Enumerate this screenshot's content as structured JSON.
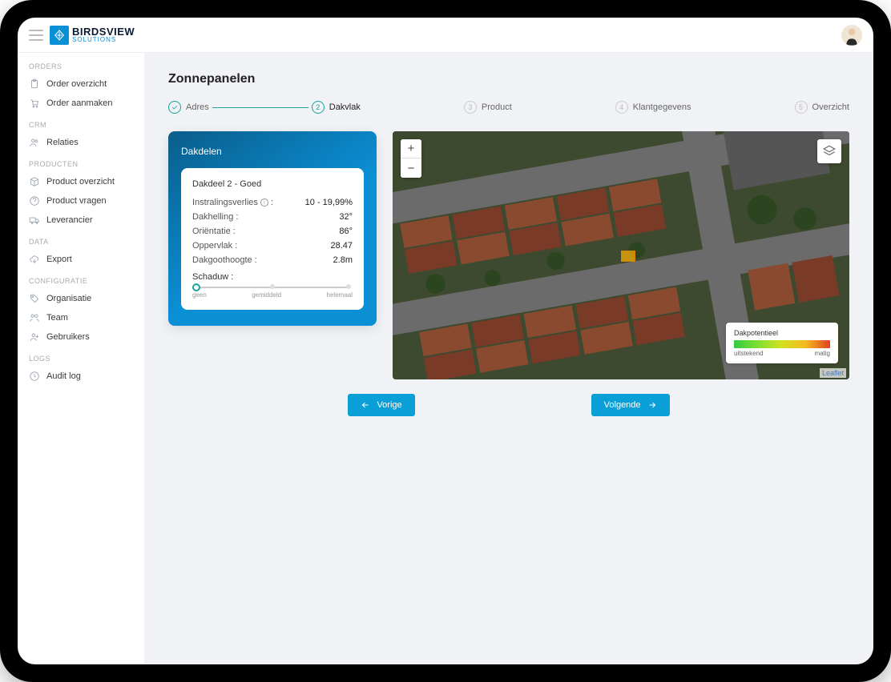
{
  "brand": {
    "primary": "BIRDSVIEW",
    "secondary": "SOLUTIONS"
  },
  "sidebar": {
    "groups": [
      {
        "header": "ORDERS",
        "items": [
          {
            "label": "Order overzicht"
          },
          {
            "label": "Order aanmaken"
          }
        ]
      },
      {
        "header": "CRM",
        "items": [
          {
            "label": "Relaties"
          }
        ]
      },
      {
        "header": "PRODUCTEN",
        "items": [
          {
            "label": "Product overzicht"
          },
          {
            "label": "Product vragen"
          },
          {
            "label": "Leverancier"
          }
        ]
      },
      {
        "header": "DATA",
        "items": [
          {
            "label": "Export"
          }
        ]
      },
      {
        "header": "CONFIGURATIE",
        "items": [
          {
            "label": "Organisatie"
          },
          {
            "label": "Team"
          },
          {
            "label": "Gebruikers"
          }
        ]
      },
      {
        "header": "LOGS",
        "items": [
          {
            "label": "Audit log"
          }
        ]
      }
    ]
  },
  "page": {
    "title": "Zonnepanelen"
  },
  "stepper": {
    "steps": [
      {
        "label": "Adres",
        "state": "done"
      },
      {
        "label": "Dakvlak",
        "state": "active",
        "num": "2"
      },
      {
        "label": "Product",
        "state": "inactive",
        "num": "3"
      },
      {
        "label": "Klantgegevens",
        "state": "inactive",
        "num": "4"
      },
      {
        "label": "Overzicht",
        "state": "inactive",
        "num": "5"
      }
    ]
  },
  "card": {
    "title": "Dakdelen",
    "item_title": "Dakdeel 2 - Goed",
    "rows": {
      "instralingsverlies": {
        "label": "Instralingsverlies",
        "value": "10 - 19,99%"
      },
      "dakhelling": {
        "label": "Dakhelling :",
        "value": "32°"
      },
      "orientatie": {
        "label": "Oriëntatie :",
        "value": "86°"
      },
      "oppervlak": {
        "label": "Oppervlak :",
        "value": "28.47"
      },
      "dakgoothoogte": {
        "label": "Dakgoothoogte :",
        "value": "2.8m"
      },
      "schaduw": {
        "label": "Schaduw :"
      }
    },
    "slider": {
      "low": "geen",
      "mid": "gemiddeld",
      "high": "helemaal"
    }
  },
  "map": {
    "legend_title": "Dakpotentieel",
    "legend_low": "uitstekend",
    "legend_high": "matig",
    "attribution": "Leaflet"
  },
  "nav": {
    "prev": "Vorige",
    "next": "Volgende"
  }
}
